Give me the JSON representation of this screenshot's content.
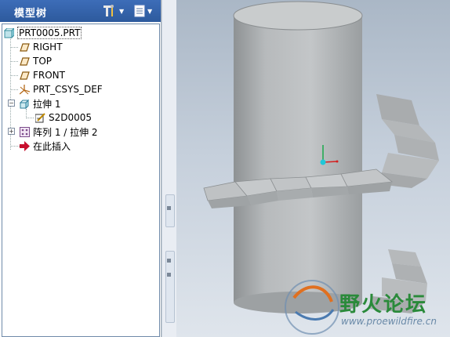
{
  "tree": {
    "title": "模型树",
    "settings_icon": "tree-settings-icon",
    "show_icon": "tree-show-icon",
    "items": [
      {
        "label": "PRT0005.PRT",
        "icon": "part-icon"
      },
      {
        "label": "RIGHT",
        "icon": "datum-plane-icon"
      },
      {
        "label": "TOP",
        "icon": "datum-plane-icon"
      },
      {
        "label": "FRONT",
        "icon": "datum-plane-icon"
      },
      {
        "label": "PRT_CSYS_DEF",
        "icon": "csys-icon"
      },
      {
        "label": "拉伸 1",
        "icon": "extrude-icon"
      },
      {
        "label": "S2D0005",
        "icon": "sketch-icon"
      },
      {
        "label": "阵列 1 / 拉伸 2",
        "icon": "pattern-icon"
      },
      {
        "label": "在此插入",
        "icon": "insert-here-arrow-icon"
      }
    ]
  },
  "watermark": {
    "text": "野火论坛",
    "url": "www.proewildfire.cn"
  },
  "colors": {
    "header": "#2d5a9d",
    "graphics_top": "#aab7c6",
    "graphics_bottom": "#dfe5ec",
    "model": "#b9bcbe",
    "insert_arrow": "#c8102e"
  }
}
